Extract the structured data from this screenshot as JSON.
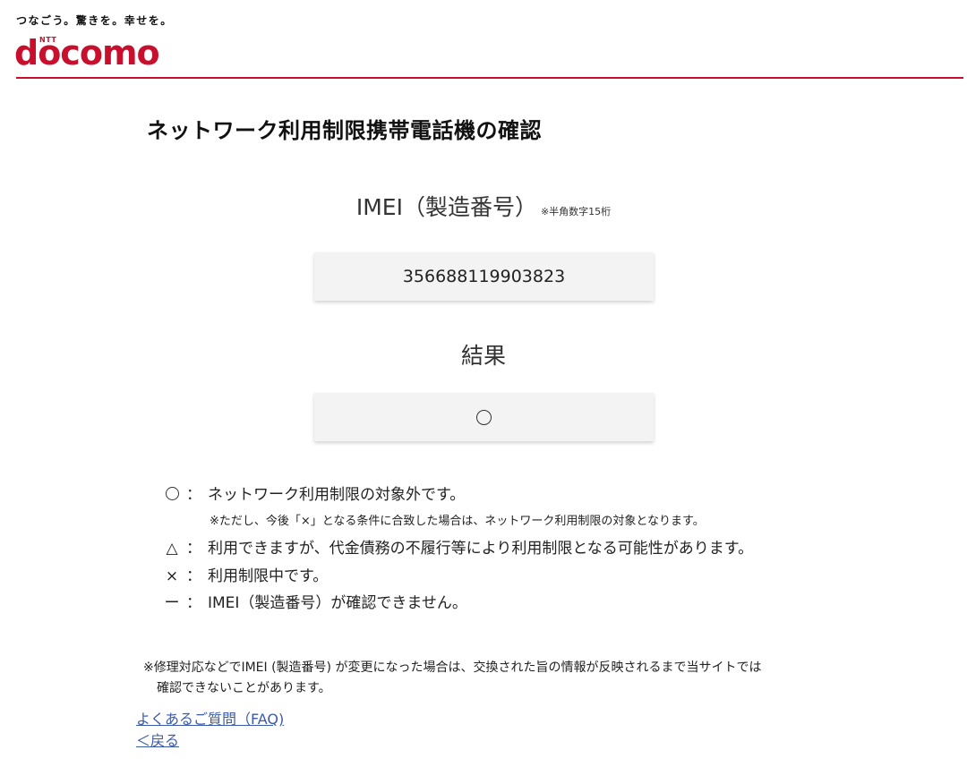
{
  "header": {
    "tagline": "つなごう。驚きを。幸せを。",
    "logo_small": "NTT",
    "logo_text": "docomo",
    "brand_color": "#c8102e"
  },
  "main": {
    "title": "ネットワーク利用制限携帯電話機の確認",
    "imei_label": "IMEI（製造番号）",
    "imei_note": "※半角数字15桁",
    "imei_value": "356688119903823",
    "result_label": "結果",
    "result_value_icon": "circle-icon"
  },
  "legend": {
    "items": [
      {
        "symbol": "○",
        "symbol_icon": "circle-icon",
        "colon": "：",
        "text": "ネットワーク利用制限の対象外です。"
      },
      {
        "symbol": "△",
        "symbol_icon": "triangle-icon",
        "colon": "：",
        "text": "利用できますが、代金債務の不履行等により利用制限となる可能性があります。"
      },
      {
        "symbol": "×",
        "symbol_icon": "cross-icon",
        "colon": "：",
        "text": "利用制限中です。"
      },
      {
        "symbol": "ー",
        "symbol_icon": "dash-icon",
        "colon": "：",
        "text": "IMEI（製造番号）が確認できません。"
      }
    ],
    "note": "※ただし、今後「×」となる条件に合致した場合は、ネットワーク利用制限の対象となります。"
  },
  "notice": {
    "line1": "※修理対応などでIMEI (製造番号) が変更になった場合は、交換された旨の情報が反映されるまで当サイトでは",
    "line2": "確認できないことがあります。"
  },
  "links": {
    "faq": "よくあるご質問（FAQ)",
    "back": "＜戻る"
  }
}
